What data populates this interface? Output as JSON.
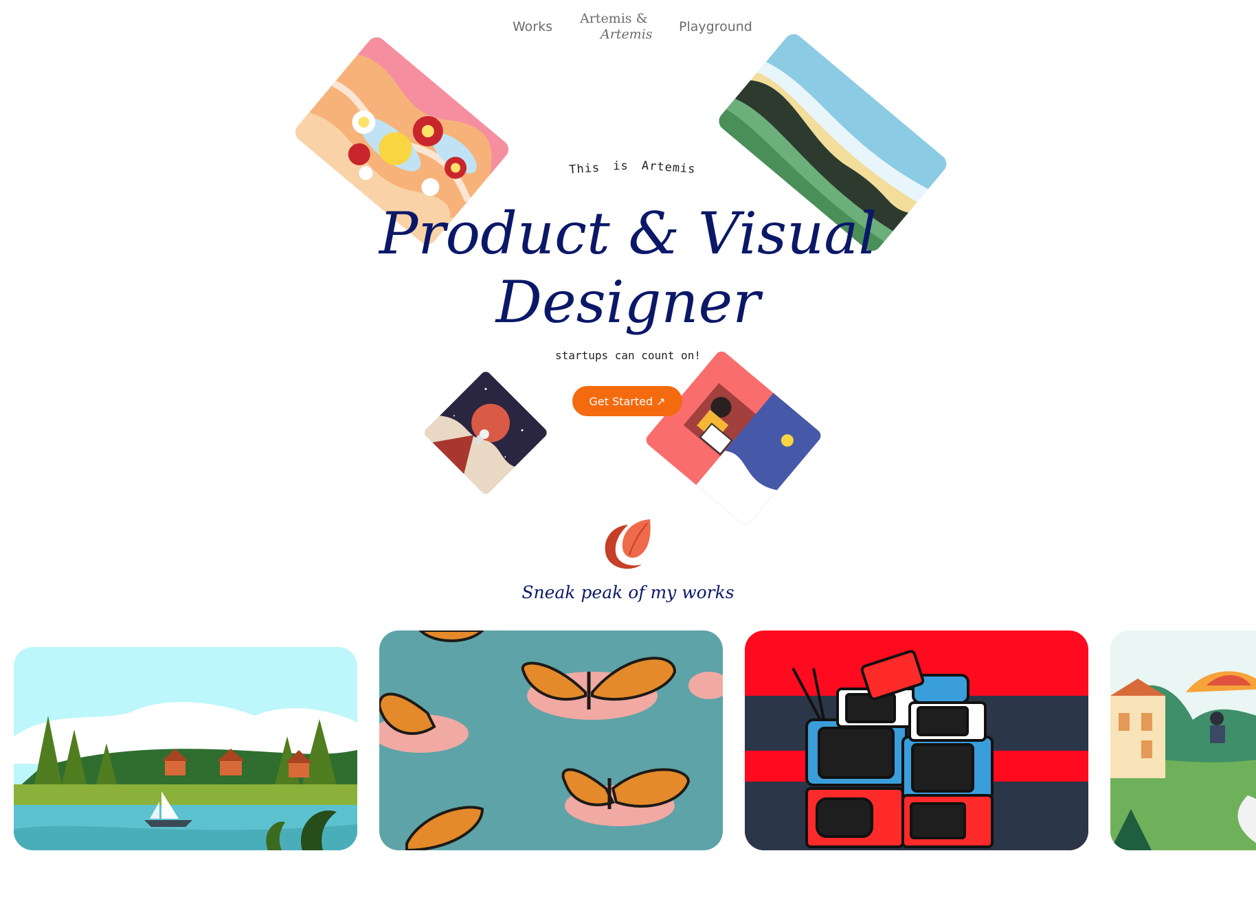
{
  "nav": {
    "works": "Works",
    "logo_line1": "Artemis &",
    "logo_line2": "Artemis",
    "playground": "Playground"
  },
  "hero": {
    "eyebrow": [
      "This",
      "is",
      "Artemis"
    ],
    "headline_line1": "Product & Visual",
    "headline_line2": "Designer",
    "subline": "startups can count on!",
    "cta_label": "Get Started ↗"
  },
  "section": {
    "title": "Sneak peak of my works",
    "icon": "leaf-logo-icon"
  },
  "colors": {
    "accent": "#f46a0e",
    "heading": "#0b1868",
    "background": "#ffffff"
  },
  "gallery": [
    {
      "name": "lake-village-illustration"
    },
    {
      "name": "monarch-butterflies-illustration"
    },
    {
      "name": "stacked-tvs-illustration"
    },
    {
      "name": "paraglider-illustration"
    }
  ]
}
